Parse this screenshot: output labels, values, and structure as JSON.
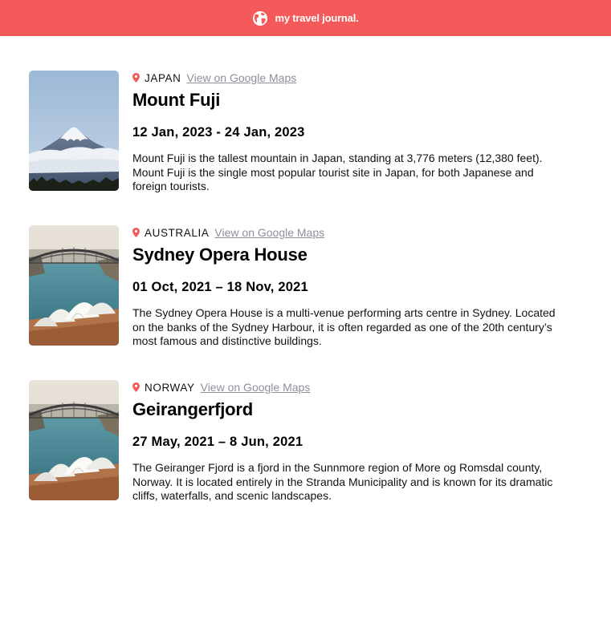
{
  "header": {
    "icon": "globe-icon",
    "title": "my travel journal.",
    "color": "#F55A5A"
  },
  "entries": [
    {
      "country": "JAPAN",
      "maps_link": "View on Google Maps",
      "title": "Mount Fuji",
      "dates": "12 Jan, 2023 - 24 Jan, 2023",
      "description": "Mount Fuji is the tallest mountain in Japan, standing at 3,776 meters (12,380 feet). Mount Fuji is the single most popular tourist site in Japan, for both Japanese and foreign tourists.",
      "image": "mount-fuji-photo"
    },
    {
      "country": "AUSTRALIA",
      "maps_link": "View on Google Maps",
      "title": "Sydney Opera House",
      "dates": "01 Oct, 2021 – 18 Nov, 2021",
      "description": "The Sydney Opera House is a multi-venue performing arts centre in Sydney. Located on the banks of the Sydney Harbour, it is often regarded as one of the 20th century’s most famous and distinctive buildings.",
      "image": "sydney-opera-house-photo"
    },
    {
      "country": "NORWAY",
      "maps_link": "View on Google Maps",
      "title": "Geirangerfjord",
      "dates": "27 May, 2021 – 8 Jun, 2021",
      "description": "The Geiranger Fjord is a fjord in the Sunnmore region of More og Romsdal county, Norway. It is located entirely in the Stranda Municipality and is known for its dramatic cliffs, waterfalls, and scenic landscapes.",
      "image": "sydney-opera-house-photo"
    }
  ]
}
